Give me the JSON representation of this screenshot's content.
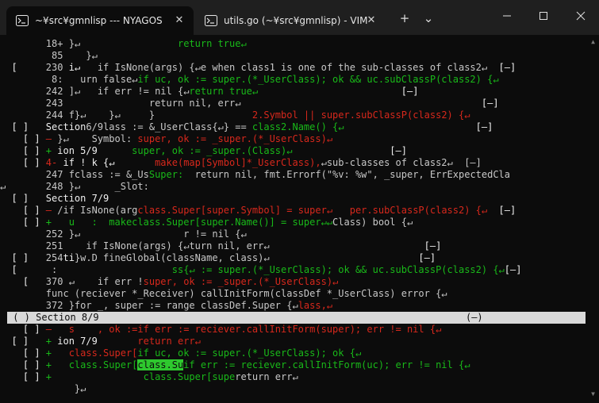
{
  "tabs": [
    {
      "title": "~¥src¥gmnlisp --- NYAGOS",
      "active": true,
      "close": "✕"
    },
    {
      "title": "utils.go (~¥src¥gmnlisp) - VIM",
      "active": false,
      "close": "✕"
    }
  ],
  "buttons": {
    "new_tab": "+",
    "dropdown": "⌄"
  },
  "colors": {
    "default": "#c8c8c8",
    "dim": "#8a8a8a",
    "red": "#d7281c",
    "green": "#19b919",
    "white": "#f0f0f0",
    "selbg": "#d9d9d9",
    "seltext": "#0c0c0c",
    "hl": "#2ec82e",
    "hlfg": "#0c0c0c"
  },
  "lines": [
    [
      [
        "        ",
        "d"
      ],
      [
        "18+ ",
        "d"
      ],
      [
        "}↵                 ",
        "d"
      ],
      [
        "return true↵",
        "g"
      ]
    ],
    [
      [
        "        ",
        "d"
      ],
      [
        " 85 ",
        "d"
      ],
      [
        "   }↵",
        "d"
      ]
    ],
    [
      [
        "  [     ",
        "w"
      ],
      [
        "230 ",
        "d"
      ],
      [
        "i↵   ",
        "w"
      ],
      [
        "if IsNone(args) {↵e when class1 is one of the sub-classes of class2↵",
        "d"
      ],
      [
        "  [–]",
        "w"
      ]
    ],
    [
      [
        "        ",
        "d"
      ],
      [
        " 8: ",
        "d"
      ],
      [
        "  urn false↵",
        "d"
      ],
      [
        "if uc, ok := super.(*_UserClass); ok && uc.subClassP(class2) {↵",
        "g"
      ]
    ],
    [
      [
        "        ",
        "d"
      ],
      [
        "242 ",
        "d"
      ],
      [
        "]↵   if err != nil {↵",
        "d"
      ],
      [
        "return true↵",
        "g"
      ],
      [
        "                         [–]",
        "w"
      ]
    ],
    [
      [
        "        ",
        "d"
      ],
      [
        "243 ",
        "d"
      ],
      [
        "              return nil, err↵",
        "d"
      ],
      [
        "                                          [–]",
        "w"
      ]
    ],
    [
      [
        "        ",
        "d"
      ],
      [
        "244 ",
        "d"
      ],
      [
        "f}↵    }↵     ",
        "d"
      ],
      [
        "}                 ",
        "d"
      ],
      [
        "2.Symbol || super.subClassP(class2) {↵",
        "r"
      ]
    ],
    [
      [
        "  [ ]   ",
        "w"
      ],
      [
        "Section",
        "w"
      ],
      [
        "6/9",
        "d"
      ],
      [
        "lass := &_UserClass{↵} == ",
        "d"
      ],
      [
        "class2.Name() {↵",
        "g"
      ],
      [
        "                       [–]",
        "w"
      ]
    ],
    [
      [
        "    [ ] ",
        "w"
      ],
      [
        "– ",
        "r"
      ],
      [
        "}↵    Symbol: ",
        "d"
      ],
      [
        "super, ok := _super.(*_UserClass)↵",
        "r"
      ]
    ],
    [
      [
        "    [ ] ",
        "w"
      ],
      [
        "+ ",
        "g"
      ],
      [
        "ion 5/9      ",
        "w"
      ],
      [
        "super, ok := _super.(Class)↵",
        "g"
      ],
      [
        "                 [–]",
        "w"
      ]
    ],
    [
      [
        "    [ ] ",
        "w"
      ],
      [
        "4- ",
        "r"
      ],
      [
        "if ! k {↵       ",
        "w"
      ],
      [
        "make(map[Symbol]*_UserClass),",
        "r"
      ],
      [
        "↵sub-classes of class2↵  [–]",
        "d"
      ]
    ],
    [
      [
        "        ",
        "d"
      ],
      [
        "247 ",
        "d"
      ],
      [
        "fclass := &_Us",
        "d"
      ],
      [
        "Super:  ",
        "g"
      ],
      [
        "return nil, fmt.Errorf(\"%v: %w\", _super, ErrExpectedCla",
        "d"
      ]
    ],
    [
      [
        "↵       ",
        "d"
      ],
      [
        "248 ",
        "d"
      ],
      [
        "}↵      _Slot:",
        "d"
      ]
    ],
    [
      [
        "  [ ]   ",
        "w"
      ],
      [
        "Section 7/9",
        "w"
      ]
    ],
    [
      [
        "    [ ] ",
        "w"
      ],
      [
        "– ",
        "r"
      ],
      [
        "/if IsNone(arg",
        "d"
      ],
      [
        "class.Super[super.Symbol] = super↵   ",
        "r"
      ],
      [
        "per.subClassP(class2) {↵",
        "r"
      ],
      [
        "  [–]",
        "w"
      ]
    ],
    [
      [
        "    [ ] ",
        "w"
      ],
      [
        "+ ",
        "g"
      ],
      [
        "  u   :  makeclass.Super[super.Name()] = super↵↵",
        "g"
      ],
      [
        "Class) bool {↵",
        "d"
      ]
    ],
    [
      [
        "        ",
        "d"
      ],
      [
        "252 ",
        "d"
      ],
      [
        "}↵                  r != nil {↵",
        "d"
      ]
    ],
    [
      [
        "        ",
        "d"
      ],
      [
        "251 ",
        "d"
      ],
      [
        "   if IsNone(args) {↵",
        "d"
      ],
      [
        "turn nil, err↵",
        "d"
      ],
      [
        "                           [–]",
        "w"
      ]
    ],
    [
      [
        "  [ ]   ",
        "w"
      ],
      [
        "254",
        "d"
      ],
      [
        "ti",
        "w"
      ],
      [
        "}w.D fineGlobal(className, class)↵",
        "d"
      ],
      [
        "                          [–]",
        "w"
      ]
    ],
    [
      [
        "  [     ",
        "w"
      ],
      [
        " : ",
        "d"
      ],
      [
        "                   ss{↵ := super.(*_UserClass); ok && uc.subClassP(class2) {↵",
        "g"
      ],
      [
        "[–]",
        "w"
      ]
    ],
    [
      [
        "    [   ",
        "w"
      ],
      [
        "370 ",
        "d"
      ],
      [
        "↵    if err !",
        "d"
      ],
      [
        "super, ok := _super.(*_UserClass)↵",
        "r"
      ]
    ],
    [
      [
        "        ",
        "d"
      ],
      [
        "func (reciever *_Receiver) callInitForm(classDef *_UserClass) error {↵",
        "d"
      ]
    ],
    [
      [
        "        ",
        "d"
      ],
      [
        "372 ",
        "d"
      ],
      [
        "}for _, super := range classDef.Super {↵",
        "d"
      ],
      [
        "lass,↵",
        "r"
      ]
    ],
    [
      [
        " ( ) Section 8/9                                                                (–)",
        "s"
      ]
    ],
    [
      [
        "    [ ] ",
        "w"
      ],
      [
        "– ",
        "r"
      ],
      [
        "  s    , ok :=if err := reciever.callInitForm(super); err != nil {↵",
        "r"
      ]
    ],
    [
      [
        "  [ ]   ",
        "w"
      ],
      [
        "+ ",
        "g"
      ],
      [
        "ion 7/9       ",
        "w"
      ],
      [
        "return err↵",
        "r"
      ]
    ],
    [
      [
        "    [ ] ",
        "w"
      ],
      [
        "+ ",
        "g"
      ],
      [
        "  class.Super[",
        "r"
      ],
      [
        "if uc, ok := super.(*_UserClass); ok {↵",
        "g"
      ]
    ],
    [
      [
        "    [ ] ",
        "w"
      ],
      [
        "+ ",
        "g"
      ],
      [
        "  class.Super[",
        "g"
      ],
      [
        "class.Su",
        "h"
      ],
      [
        "if err := reciever.callInitForm(uc); err != nil {↵",
        "g"
      ]
    ],
    [
      [
        "    [ ] ",
        "w"
      ],
      [
        "+ ",
        "g"
      ],
      [
        "               class.Super[supe",
        "g"
      ],
      [
        "return err↵",
        "d"
      ]
    ],
    [
      [
        "        ",
        "d"
      ],
      [
        "     }↵",
        "d"
      ]
    ]
  ]
}
